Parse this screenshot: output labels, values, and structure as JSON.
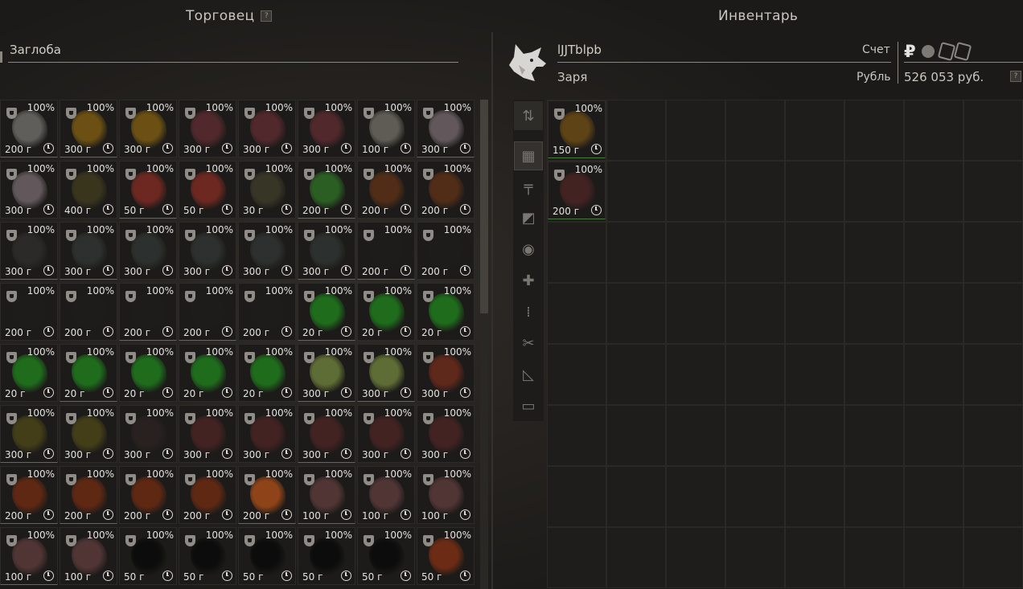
{
  "trader_panel": {
    "title": "Торговец",
    "help_label": "?",
    "trader_name": "Заглоба"
  },
  "inventory_panel": {
    "title": "Инвентарь",
    "player_name": "lJJTblpb",
    "faction": "Заря",
    "account_label": "Счет",
    "currency_label": "Рубль",
    "balance": "526 053 руб.",
    "currency_symbol": "₽",
    "help_label": "?"
  },
  "sidebar_tabs": [
    {
      "icon": "sort-icon",
      "glyph": "⇅"
    },
    {
      "icon": "grid-icon",
      "glyph": "▦"
    },
    {
      "icon": "weapon-icon",
      "glyph": "╤"
    },
    {
      "icon": "armor-icon",
      "glyph": "◩"
    },
    {
      "icon": "artifact-icon",
      "glyph": "◉"
    },
    {
      "icon": "medkit-icon",
      "glyph": "✚"
    },
    {
      "icon": "ammo-icon",
      "glyph": "⁞"
    },
    {
      "icon": "tools-icon",
      "glyph": "✂"
    },
    {
      "icon": "blueprint-icon",
      "glyph": "◺"
    },
    {
      "icon": "box-icon",
      "glyph": "▭"
    }
  ],
  "trader_items": [
    {
      "pct": "100%",
      "weight": "200 г",
      "color": "#6c6a66"
    },
    {
      "pct": "100%",
      "weight": "300 г",
      "color": "#7a5a12"
    },
    {
      "pct": "100%",
      "weight": "300 г",
      "color": "#7a5a12"
    },
    {
      "pct": "100%",
      "weight": "300 г",
      "color": "#5a2a2f"
    },
    {
      "pct": "100%",
      "weight": "300 г",
      "color": "#5a2a2f"
    },
    {
      "pct": "100%",
      "weight": "300 г",
      "color": "#5a2a2f"
    },
    {
      "pct": "100%",
      "weight": "100 г",
      "color": "#6a6760"
    },
    {
      "pct": "100%",
      "weight": "300 г",
      "color": "#6e6368"
    },
    {
      "pct": "100%",
      "weight": "300 г",
      "color": "#6e6368"
    },
    {
      "pct": "100%",
      "weight": "400 г",
      "color": "#3e3a1e"
    },
    {
      "pct": "100%",
      "weight": "50 г",
      "color": "#7a2a22"
    },
    {
      "pct": "100%",
      "weight": "50 г",
      "color": "#7a2a22"
    },
    {
      "pct": "100%",
      "weight": "30 г",
      "color": "#3c3a28"
    },
    {
      "pct": "100%",
      "weight": "200 г",
      "color": "#2e6a25"
    },
    {
      "pct": "100%",
      "weight": "200 г",
      "color": "#5a3018"
    },
    {
      "pct": "100%",
      "weight": "200 г",
      "color": "#5a3018"
    },
    {
      "pct": "100%",
      "weight": "300 г",
      "color": "#2d2c2b"
    },
    {
      "pct": "100%",
      "weight": "300 г",
      "color": "#2f3331"
    },
    {
      "pct": "100%",
      "weight": "300 г",
      "color": "#2f3331"
    },
    {
      "pct": "100%",
      "weight": "300 г",
      "color": "#2f3331"
    },
    {
      "pct": "100%",
      "weight": "300 г",
      "color": "#2f3331"
    },
    {
      "pct": "100%",
      "weight": "300 г",
      "color": "#2f3331"
    },
    {
      "pct": "100%",
      "weight": "200 г",
      "color": "#1d1c1b"
    },
    {
      "pct": "100%",
      "weight": "200 г",
      "color": "#1d1c1b"
    },
    {
      "pct": "100%",
      "weight": "200 г",
      "color": "#1d1c1b"
    },
    {
      "pct": "100%",
      "weight": "200 г",
      "color": "#1d1c1b"
    },
    {
      "pct": "100%",
      "weight": "200 г",
      "color": "#1d1c1b"
    },
    {
      "pct": "100%",
      "weight": "200 г",
      "color": "#1d1c1b"
    },
    {
      "pct": "100%",
      "weight": "200 г",
      "color": "#1d1c1b"
    },
    {
      "pct": "100%",
      "weight": "20 г",
      "color": "#1f7a1c"
    },
    {
      "pct": "100%",
      "weight": "20 г",
      "color": "#1f7a1c"
    },
    {
      "pct": "100%",
      "weight": "20 г",
      "color": "#1f7a1c"
    },
    {
      "pct": "100%",
      "weight": "20 г",
      "color": "#1f7a1c"
    },
    {
      "pct": "100%",
      "weight": "20 г",
      "color": "#1f7a1c"
    },
    {
      "pct": "100%",
      "weight": "20 г",
      "color": "#1f7a1c"
    },
    {
      "pct": "100%",
      "weight": "20 г",
      "color": "#1f7a1c"
    },
    {
      "pct": "100%",
      "weight": "20 г",
      "color": "#1f7a1c"
    },
    {
      "pct": "100%",
      "weight": "300 г",
      "color": "#6a7a3a"
    },
    {
      "pct": "100%",
      "weight": "300 г",
      "color": "#6a7a3a"
    },
    {
      "pct": "100%",
      "weight": "300 г",
      "color": "#6a2a1a"
    },
    {
      "pct": "100%",
      "weight": "300 г",
      "color": "#4a4418"
    },
    {
      "pct": "100%",
      "weight": "300 г",
      "color": "#4a4418"
    },
    {
      "pct": "100%",
      "weight": "300 г",
      "color": "#2a2220"
    },
    {
      "pct": "100%",
      "weight": "300 г",
      "color": "#4a2424"
    },
    {
      "pct": "100%",
      "weight": "300 г",
      "color": "#4a2424"
    },
    {
      "pct": "100%",
      "weight": "300 г",
      "color": "#4a2424"
    },
    {
      "pct": "100%",
      "weight": "300 г",
      "color": "#4a2424"
    },
    {
      "pct": "100%",
      "weight": "300 г",
      "color": "#4a2424"
    },
    {
      "pct": "100%",
      "weight": "200 г",
      "color": "#6a2a12"
    },
    {
      "pct": "100%",
      "weight": "200 г",
      "color": "#6a2a12"
    },
    {
      "pct": "100%",
      "weight": "200 г",
      "color": "#6a2a12"
    },
    {
      "pct": "100%",
      "weight": "200 г",
      "color": "#6a2a12"
    },
    {
      "pct": "100%",
      "weight": "200 г",
      "color": "#a24a18"
    },
    {
      "pct": "100%",
      "weight": "100 г",
      "color": "#5a3a3a"
    },
    {
      "pct": "100%",
      "weight": "100 г",
      "color": "#5a3a3a"
    },
    {
      "pct": "100%",
      "weight": "100 г",
      "color": "#5a3a3a"
    },
    {
      "pct": "100%",
      "weight": "100 г",
      "color": "#5a3a3a"
    },
    {
      "pct": "100%",
      "weight": "100 г",
      "color": "#5a3a3a"
    },
    {
      "pct": "100%",
      "weight": "50 г",
      "color": "#0a0a0a"
    },
    {
      "pct": "100%",
      "weight": "50 г",
      "color": "#0a0a0a"
    },
    {
      "pct": "100%",
      "weight": "50 г",
      "color": "#0a0a0a"
    },
    {
      "pct": "100%",
      "weight": "50 г",
      "color": "#0a0a0a"
    },
    {
      "pct": "100%",
      "weight": "50 г",
      "color": "#0a0a0a"
    },
    {
      "pct": "100%",
      "weight": "50 г",
      "color": "#7a2e14"
    }
  ],
  "inventory_items": [
    {
      "pct": "100%",
      "weight": "150 г",
      "color": "#6a4a16"
    },
    {
      "pct": "100%",
      "weight": "200 г",
      "color": "#4a2424"
    }
  ]
}
